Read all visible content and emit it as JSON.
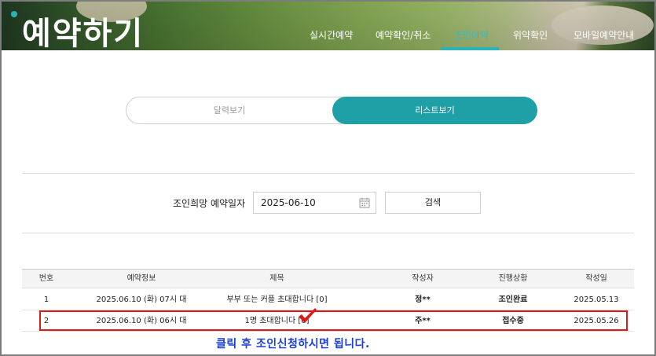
{
  "header": {
    "title": "예약하기",
    "nav": [
      {
        "label": "실시간예약",
        "active": false
      },
      {
        "label": "예약확인/취소",
        "active": false
      },
      {
        "label": "조인예약",
        "active": true
      },
      {
        "label": "위약확인",
        "active": false
      },
      {
        "label": "모바일예약안내",
        "active": false
      }
    ]
  },
  "view_toggle": {
    "calendar_label": "달력보기",
    "list_label": "리스트보기",
    "selected": "list"
  },
  "search": {
    "label": "조인희망 예약일자",
    "date_value": "2025-06-10",
    "button_label": "검색"
  },
  "table": {
    "columns": [
      "번호",
      "예약정보",
      "제목",
      "작성자",
      "진행상황",
      "작성일"
    ],
    "rows": [
      {
        "no": "1",
        "info": "2025.06.10 (화) 07시 대",
        "title": "부부 또는 커플 초대합니다 [0]",
        "author": "정**",
        "status": "조인완료",
        "date": "2025.05.13"
      },
      {
        "no": "2",
        "info": "2025.06.10 (화) 06시 대",
        "title": "1명 초대합니다 [0]",
        "author": "주**",
        "status": "접수중",
        "date": "2025.05.26"
      }
    ]
  },
  "annotation": {
    "note": "클릭 후 조인신청하시면 됩니다.",
    "highlight_color": "#e01818",
    "note_color": "#1b3fd6"
  },
  "colors": {
    "accent": "#1f9fa6"
  }
}
